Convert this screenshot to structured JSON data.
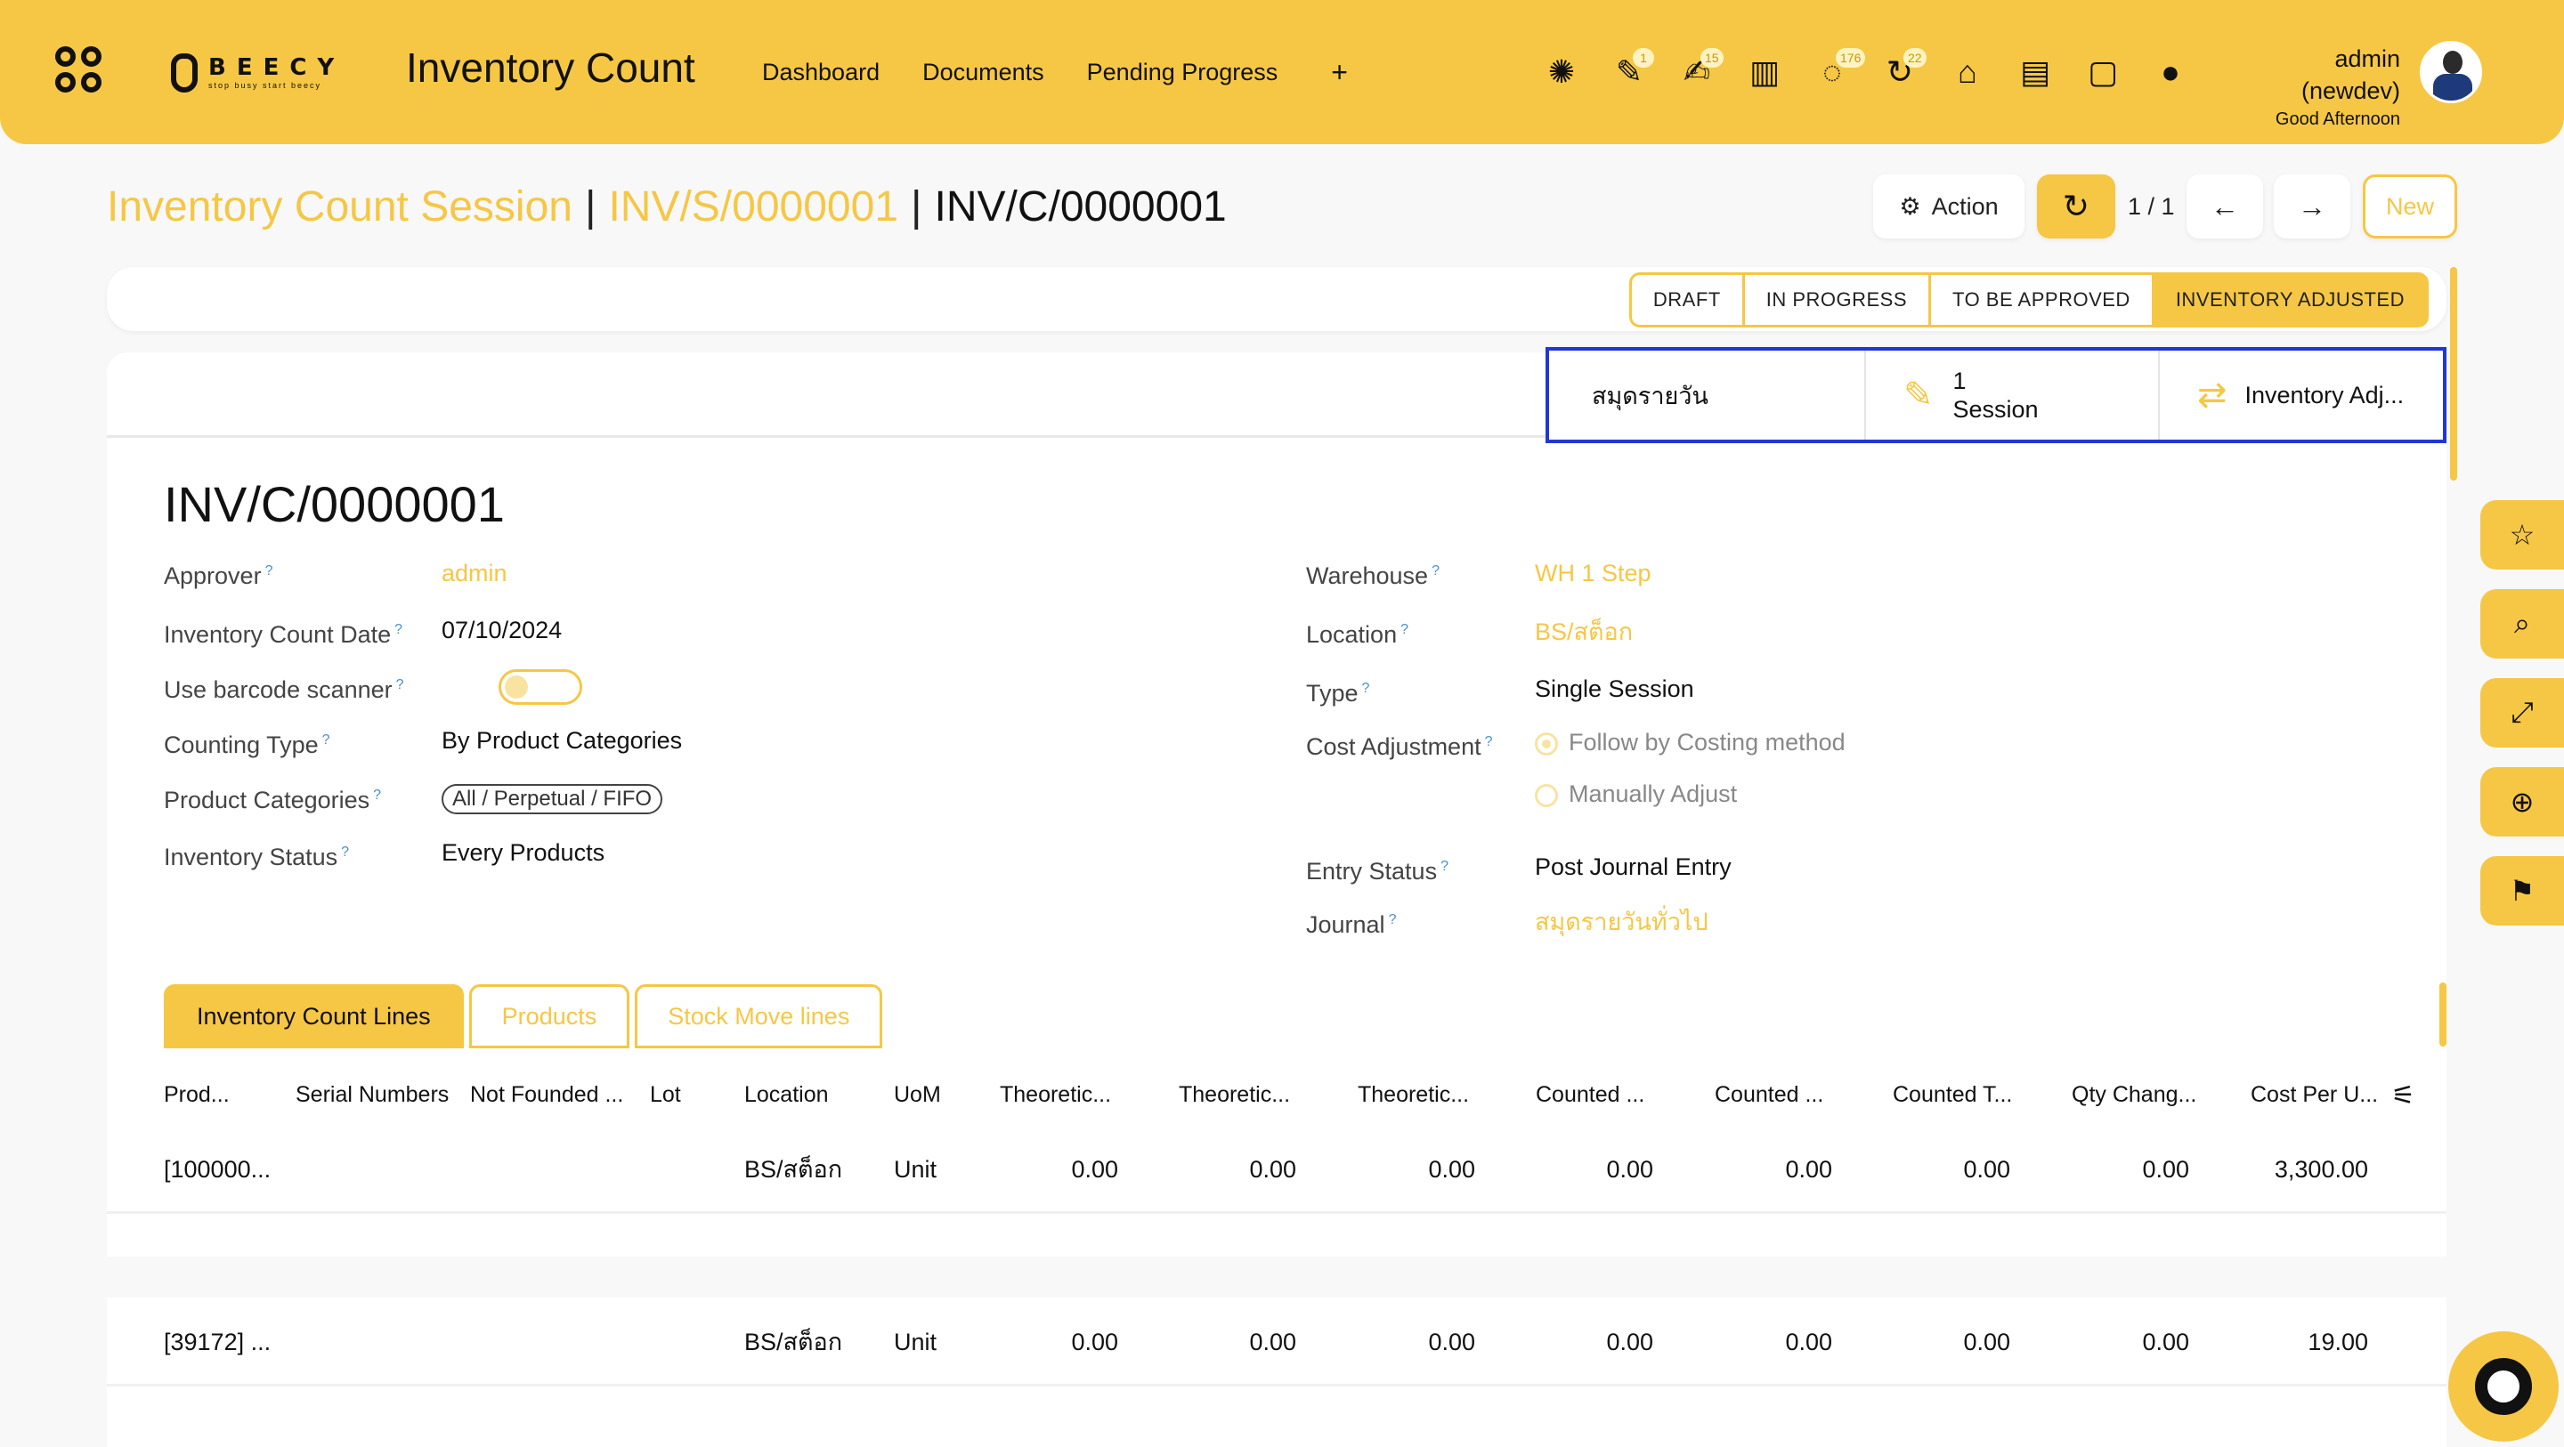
{
  "topbar": {
    "logo_word": "BEECY",
    "logo_tagline": "stop busy start beecy",
    "app_title": "Inventory Count",
    "nav": [
      "Dashboard",
      "Documents",
      "Pending Progress"
    ],
    "nav_add": "+",
    "icons": [
      {
        "name": "bug-icon",
        "glyph": "✺",
        "badge": ""
      },
      {
        "name": "pencil-icon",
        "glyph": "✎",
        "badge": "1"
      },
      {
        "name": "edit-note-icon",
        "glyph": "✍",
        "badge": "15"
      },
      {
        "name": "barcode-icon",
        "glyph": "▥",
        "badge": ""
      },
      {
        "name": "chat-icon",
        "glyph": "◌",
        "badge": "176"
      },
      {
        "name": "history-icon",
        "glyph": "↻",
        "badge": "22"
      },
      {
        "name": "bank-icon",
        "glyph": "⌂",
        "badge": ""
      },
      {
        "name": "paint-roller-icon",
        "glyph": "▤",
        "badge": ""
      },
      {
        "name": "sticky-note-icon",
        "glyph": "▢",
        "badge": ""
      },
      {
        "name": "lightbulb-icon",
        "glyph": "●",
        "badge": ""
      }
    ],
    "user_name": "admin (newdev)",
    "greeting": "Good Afternoon"
  },
  "breadcrumb": {
    "items": [
      "Inventory Count Session",
      "INV/S/0000001"
    ],
    "current": "INV/C/0000001",
    "separator": "|"
  },
  "controls": {
    "action_label": "Action",
    "pager": "1 / 1",
    "new_label": "New"
  },
  "stages": [
    "DRAFT",
    "IN PROGRESS",
    "TO BE APPROVED",
    "INVENTORY ADJUSTED"
  ],
  "active_stage": "INVENTORY ADJUSTED",
  "smart_buttons": {
    "journal": "สมุดรายวัน",
    "session_count": "1",
    "session_label": "Session",
    "adjustment": "Inventory Adj..."
  },
  "form": {
    "title": "INV/C/0000001",
    "left": {
      "approver_label": "Approver",
      "approver": "admin",
      "date_label": "Inventory Count Date",
      "date": "07/10/2024",
      "barcode_label": "Use barcode scanner",
      "counting_type_label": "Counting Type",
      "counting_type": "By Product Categories",
      "categories_label": "Product Categories",
      "categories_tag": "All / Perpetual / FIFO",
      "status_label": "Inventory Status",
      "status": "Every Products"
    },
    "right": {
      "warehouse_label": "Warehouse",
      "warehouse": "WH 1 Step",
      "location_label": "Location",
      "location": "BS/สต็อก",
      "type_label": "Type",
      "type": "Single Session",
      "cost_label": "Cost Adjustment",
      "cost_opt1": "Follow by Costing method",
      "cost_opt2": "Manually Adjust",
      "entry_label": "Entry Status",
      "entry": "Post Journal Entry",
      "journal_label": "Journal",
      "journal": "สมุดรายวันทั่วไป"
    },
    "help_mark": "?"
  },
  "tabs": [
    "Inventory Count Lines",
    "Products",
    "Stock Move lines"
  ],
  "table": {
    "columns": [
      "Prod...",
      "Serial Numbers",
      "Not Founded ...",
      "Lot",
      "Location",
      "UoM",
      "Theoretic...",
      "Theoretic...",
      "Theoretic...",
      "Counted ...",
      "Counted ...",
      "Counted T...",
      "Qty Chang...",
      "Cost Per U..."
    ],
    "rows": [
      [
        "[100000...",
        "",
        "",
        "",
        "BS/สต็อก",
        "Unit",
        "0.00",
        "0.00",
        "0.00",
        "0.00",
        "0.00",
        "0.00",
        "0.00",
        "3,300.00"
      ],
      [
        "[39172] ...",
        "",
        "",
        "",
        "BS/สต็อก",
        "Unit",
        "0.00",
        "0.00",
        "0.00",
        "0.00",
        "0.00",
        "0.00",
        "0.00",
        "19.00"
      ]
    ]
  },
  "side_tools": [
    {
      "name": "star-icon",
      "glyph": "☆"
    },
    {
      "name": "search-icon",
      "glyph": "⌕"
    },
    {
      "name": "expand-icon",
      "glyph": "⤢"
    },
    {
      "name": "zoom-in-icon",
      "glyph": "⊕"
    },
    {
      "name": "bookmark-icon",
      "glyph": "⚑"
    }
  ]
}
